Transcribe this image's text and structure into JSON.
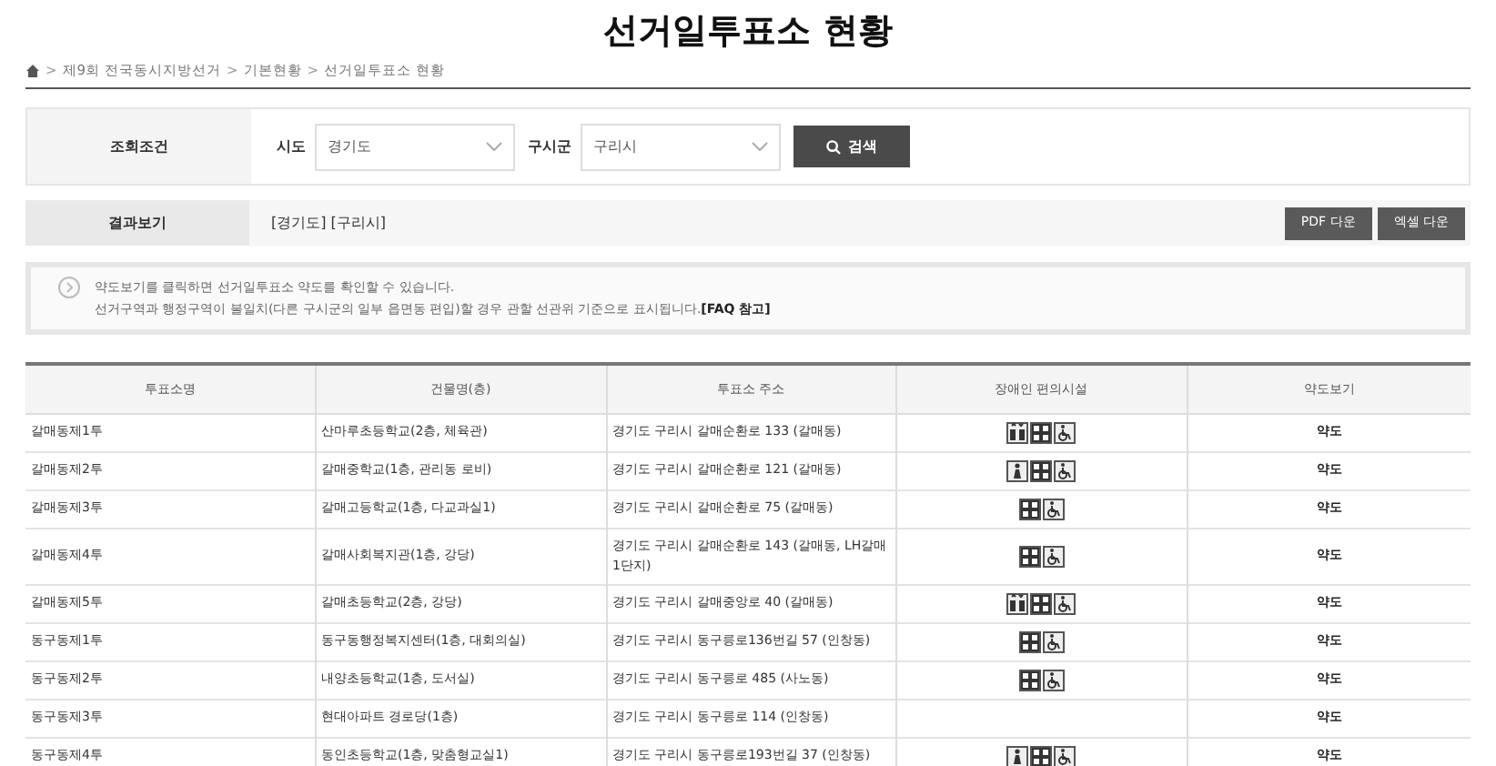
{
  "title": "선거일투표소 현황",
  "breadcrumb": [
    {
      "separator": ">",
      "label": "제9회 전국동시지방선거"
    },
    {
      "separator": ">",
      "label": "기본현황"
    },
    {
      "separator": ">",
      "label": "선거일투표소 현황"
    }
  ],
  "search": {
    "label": "조회조건",
    "fields": [
      {
        "label": "시도",
        "value": "경기도"
      },
      {
        "label": "구시군",
        "value": "구리시"
      }
    ],
    "button": "검색"
  },
  "result": {
    "label": "결과보기",
    "value": "[경기도] [구리시]",
    "buttons": [
      "PDF 다운",
      "엑셀 다운"
    ]
  },
  "notice": {
    "lines": [
      "약도보기를 클릭하면 선거일투표소 약도를 확인할 수 있습니다.",
      "선거구역과 행정구역이 불일치(다른 구시군의 일부 읍면동 편입)할 경우 관할 선관위 기준으로 표시됩니다.**[FAQ 참고]**"
    ]
  },
  "table": {
    "columns": [
      "투표소명",
      "건물명(층)",
      "투표소 주소",
      "장애인 편의시설",
      "약도보기"
    ],
    "rows": [
      {
        "name": "갈매동제1투",
        "building": "산마루초등학교(2층, 체육관)",
        "address": "경기도 구리시 갈매순환로 133 (갈매동)",
        "facilities": [
          {
            "kind": "lift"
          },
          {
            "kind": "grid"
          },
          {
            "kind": "wheelchair"
          }
        ],
        "map": "약도"
      },
      {
        "name": "갈매동제2투",
        "building": "갈매중학교(1층, 관리동 로비)",
        "address": "경기도 구리시 갈매순환로 121 (갈매동)",
        "facilities": [
          {
            "kind": "person"
          },
          {
            "kind": "grid"
          },
          {
            "kind": "wheelchair"
          }
        ],
        "map": "약도"
      },
      {
        "name": "갈매동제3투",
        "building": "갈매고등학교(1층, 다교과실1)",
        "address": "경기도 구리시 갈매순환로 75 (갈매동)",
        "facilities": [
          {
            "kind": "grid"
          },
          {
            "kind": "wheelchair"
          }
        ],
        "map": "약도"
      },
      {
        "name": "갈매동제4투",
        "building": "갈매사회복지관(1층, 강당)",
        "address": "경기도 구리시 갈매순환로 143 (갈매동, LH갈매1단지)",
        "facilities": [
          {
            "kind": "grid"
          },
          {
            "kind": "wheelchair"
          }
        ],
        "map": "약도"
      },
      {
        "name": "갈매동제5투",
        "building": "갈매초등학교(2층, 강당)",
        "address": "경기도 구리시 갈매중앙로 40 (갈매동)",
        "facilities": [
          {
            "kind": "lift"
          },
          {
            "kind": "grid"
          },
          {
            "kind": "wheelchair"
          }
        ],
        "map": "약도"
      },
      {
        "name": "동구동제1투",
        "building": "동구동행정복지센터(1층, 대회의실)",
        "address": "경기도 구리시 동구릉로136번길 57 (인창동)",
        "facilities": [
          {
            "kind": "grid"
          },
          {
            "kind": "wheelchair"
          }
        ],
        "map": "약도"
      },
      {
        "name": "동구동제2투",
        "building": "내양초등학교(1층, 도서실)",
        "address": "경기도 구리시 동구릉로 485 (사노동)",
        "facilities": [
          {
            "kind": "grid"
          },
          {
            "kind": "wheelchair"
          }
        ],
        "map": "약도"
      },
      {
        "name": "동구동제3투",
        "building": "현대아파트 경로당(1층)",
        "address": "경기도 구리시 동구릉로 114 (인창동)",
        "map": "약도"
      },
      {
        "name": "동구동제4투",
        "building": "동인초등학교(1층, 맞춤형교실1)",
        "address": "경기도 구리시 동구릉로193번길 37 (인창동)",
        "facilities": [
          {
            "kind": "person"
          },
          {
            "kind": "grid"
          },
          {
            "kind": "wheelchair"
          }
        ],
        "map": "약도"
      }
    ]
  }
}
